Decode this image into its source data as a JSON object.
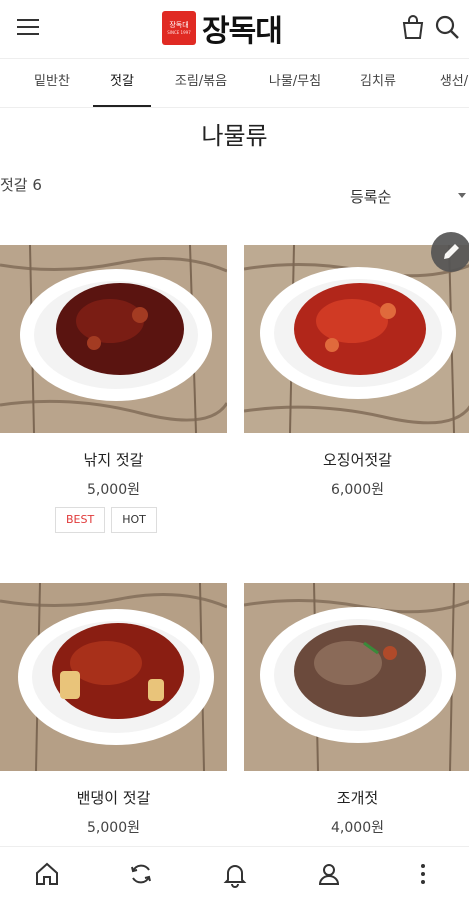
{
  "header": {
    "logo_badge_text": "장독대",
    "logo_badge_sub": "SINCE 1997",
    "logo_text": "장독대"
  },
  "tabs": [
    {
      "label": "밑반찬",
      "active": false
    },
    {
      "label": "젓갈",
      "active": true
    },
    {
      "label": "조림/볶음",
      "active": false
    },
    {
      "label": "나물/무침",
      "active": false
    },
    {
      "label": "김치류",
      "active": false
    },
    {
      "label": "생선/",
      "active": false
    }
  ],
  "page_title": "나물류",
  "count_label": "젓갈 6",
  "sort_label": "등록순",
  "products": [
    {
      "name": "낚지 젓갈",
      "price": "5,000원",
      "badges": [
        "BEST",
        "HOT"
      ]
    },
    {
      "name": "오징어젓갈",
      "price": "6,000원",
      "badges": []
    },
    {
      "name": "밴댕이 젓갈",
      "price": "5,000원",
      "badges": []
    },
    {
      "name": "조개젓",
      "price": "4,000원",
      "badges": []
    }
  ],
  "bottom_nav": [
    "home-icon",
    "refresh-icon",
    "bell-icon",
    "user-icon",
    "more-icon"
  ]
}
